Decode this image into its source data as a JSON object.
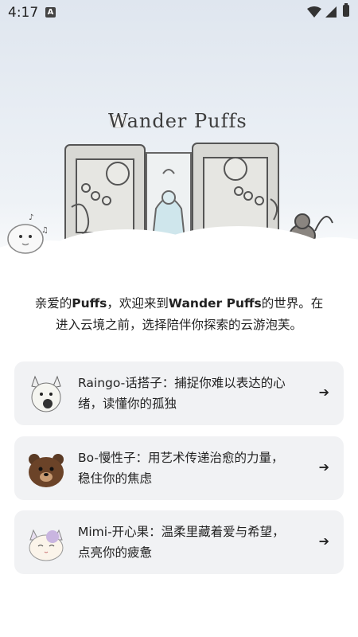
{
  "status_bar": {
    "time": "4:17",
    "notification_badge": "A"
  },
  "hero": {
    "logo_text": "Wander Puffs"
  },
  "intro": {
    "p1_prefix": "亲爱的",
    "p1_bold1": "Puffs",
    "p1_mid": "，欢迎来到",
    "p1_bold2": "Wander Puffs",
    "p1_suffix": "的世界。在",
    "line2": "进入云境之前，选择陪伴你探索的云游泡芙。"
  },
  "companions": [
    {
      "line1": "Raingo-话搭子：捕捉你难以表达的心",
      "line2": "绪，读懂你的孤独",
      "avatar_icon": "white-rabbit-icon"
    },
    {
      "line1": "Bo-慢性子：用艺术传递治愈的力量，",
      "line2": "稳住你的焦虑",
      "avatar_icon": "brown-bear-icon"
    },
    {
      "line1": "Mimi-开心果：温柔里藏着爱与希望，",
      "line2": "点亮你的疲惫",
      "avatar_icon": "fluffy-cat-icon"
    }
  ],
  "arrow_glyph": "➔",
  "colors": {
    "card_bg": "#f1f2f4",
    "text": "#222222"
  }
}
